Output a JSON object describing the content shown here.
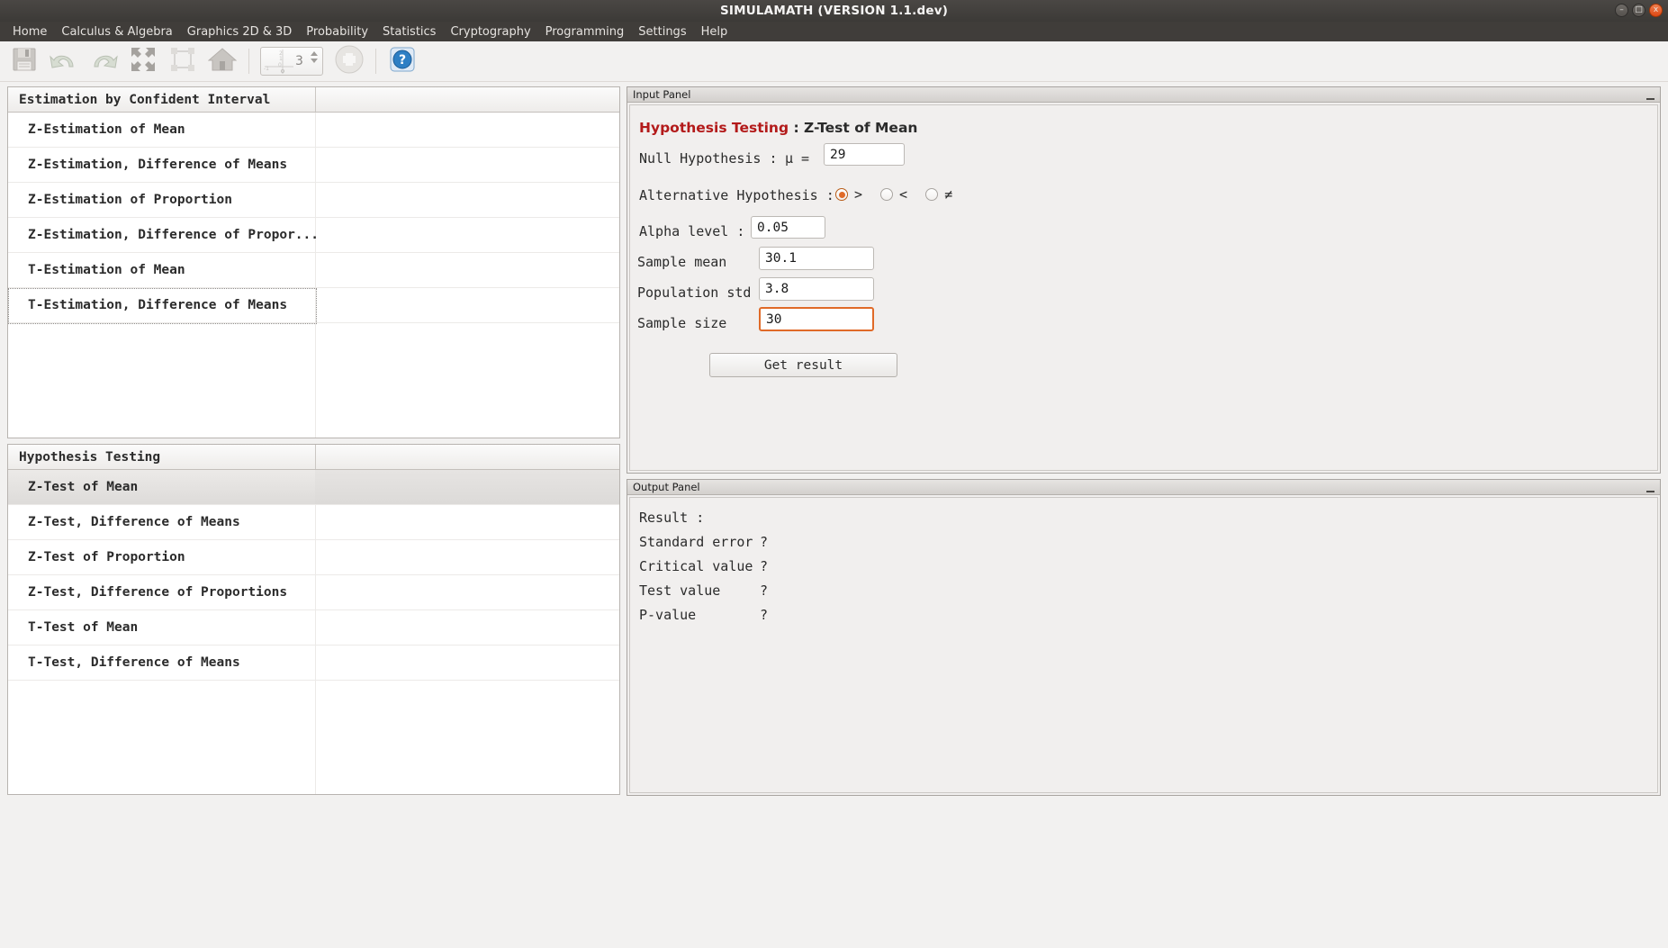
{
  "window": {
    "title": "SIMULAMATH  (VERSION 1.1.dev)",
    "controls": {
      "minimize": "–",
      "maximize": "□",
      "close": "x"
    }
  },
  "menubar": {
    "items": [
      {
        "label": "Home"
      },
      {
        "label": "Calculus & Algebra"
      },
      {
        "label": "Graphics 2D & 3D"
      },
      {
        "label": "Probability"
      },
      {
        "label": "Statistics"
      },
      {
        "label": "Cryptography"
      },
      {
        "label": "Programming"
      },
      {
        "label": "Settings"
      },
      {
        "label": "Help"
      }
    ]
  },
  "toolbar": {
    "buttons": [
      {
        "icon": "save-icon"
      },
      {
        "icon": "undo-icon"
      },
      {
        "icon": "redo-icon"
      },
      {
        "icon": "fit-expand-icon"
      },
      {
        "icon": "select-region-icon"
      },
      {
        "icon": "home-view-icon"
      }
    ],
    "spinner": {
      "value": "3",
      "icon": "axes-graph-icon"
    },
    "zoom_button": {
      "icon": "plus-circle-icon"
    },
    "help_button": {
      "icon": "help-question-icon"
    }
  },
  "left_panel": {
    "estimation_group": {
      "header": "Estimation by Confident Interval",
      "items": [
        {
          "label": "Z-Estimation of Mean",
          "selected": false,
          "focused": false
        },
        {
          "label": "Z-Estimation, Difference of Means",
          "selected": false,
          "focused": false
        },
        {
          "label": "Z-Estimation of Proportion",
          "selected": false,
          "focused": false
        },
        {
          "label": "Z-Estimation, Difference of Propor...",
          "selected": false,
          "focused": false
        },
        {
          "label": "T-Estimation of Mean",
          "selected": false,
          "focused": false
        },
        {
          "label": "T-Estimation, Difference of Means",
          "selected": false,
          "focused": true
        }
      ]
    },
    "hypothesis_group": {
      "header": "Hypothesis Testing",
      "items": [
        {
          "label": "Z-Test of Mean",
          "selected": true,
          "focused": false
        },
        {
          "label": "Z-Test, Difference of Means",
          "selected": false,
          "focused": false
        },
        {
          "label": "Z-Test of Proportion",
          "selected": false,
          "focused": false
        },
        {
          "label": "Z-Test, Difference of Proportions",
          "selected": false,
          "focused": false
        },
        {
          "label": "T-Test of Mean",
          "selected": false,
          "focused": false
        },
        {
          "label": "T-Test, Difference of Means",
          "selected": false,
          "focused": false
        }
      ]
    }
  },
  "input_panel": {
    "dock_title": "Input Panel",
    "heading_accent": "Hypothesis Testing",
    "heading_rest": " : Z-Test of Mean",
    "null_hypothesis_label": "Null Hypothesis :",
    "mu_label": "μ =",
    "mu_value": "29",
    "alternative_label": "Alternative Hypothesis :",
    "alternatives": [
      {
        "symbol": ">",
        "selected": true
      },
      {
        "symbol": "<",
        "selected": false
      },
      {
        "symbol": "≠",
        "selected": false
      }
    ],
    "alpha_label": "Alpha level :",
    "alpha_value": "0.05",
    "sample_mean_label": "Sample mean",
    "sample_mean_value": "30.1",
    "population_std_label": "Population std",
    "population_std_value": "3.8",
    "sample_size_label": "Sample size",
    "sample_size_value": "30",
    "get_result_label": "Get result"
  },
  "output_panel": {
    "dock_title": "Output Panel",
    "result_label": "Result :",
    "rows": [
      {
        "label": "Standard error",
        "value": "?"
      },
      {
        "label": "Critical value",
        "value": "?"
      },
      {
        "label": "Test value",
        "value": "?"
      },
      {
        "label": "P-value",
        "value": "?"
      }
    ]
  },
  "colors": {
    "accent_orange": "#e06a28",
    "heading_red": "#b31a1a",
    "titlebar": "#3c3a37",
    "menubar": "#403d3a",
    "panel_bg": "#f1efee"
  }
}
